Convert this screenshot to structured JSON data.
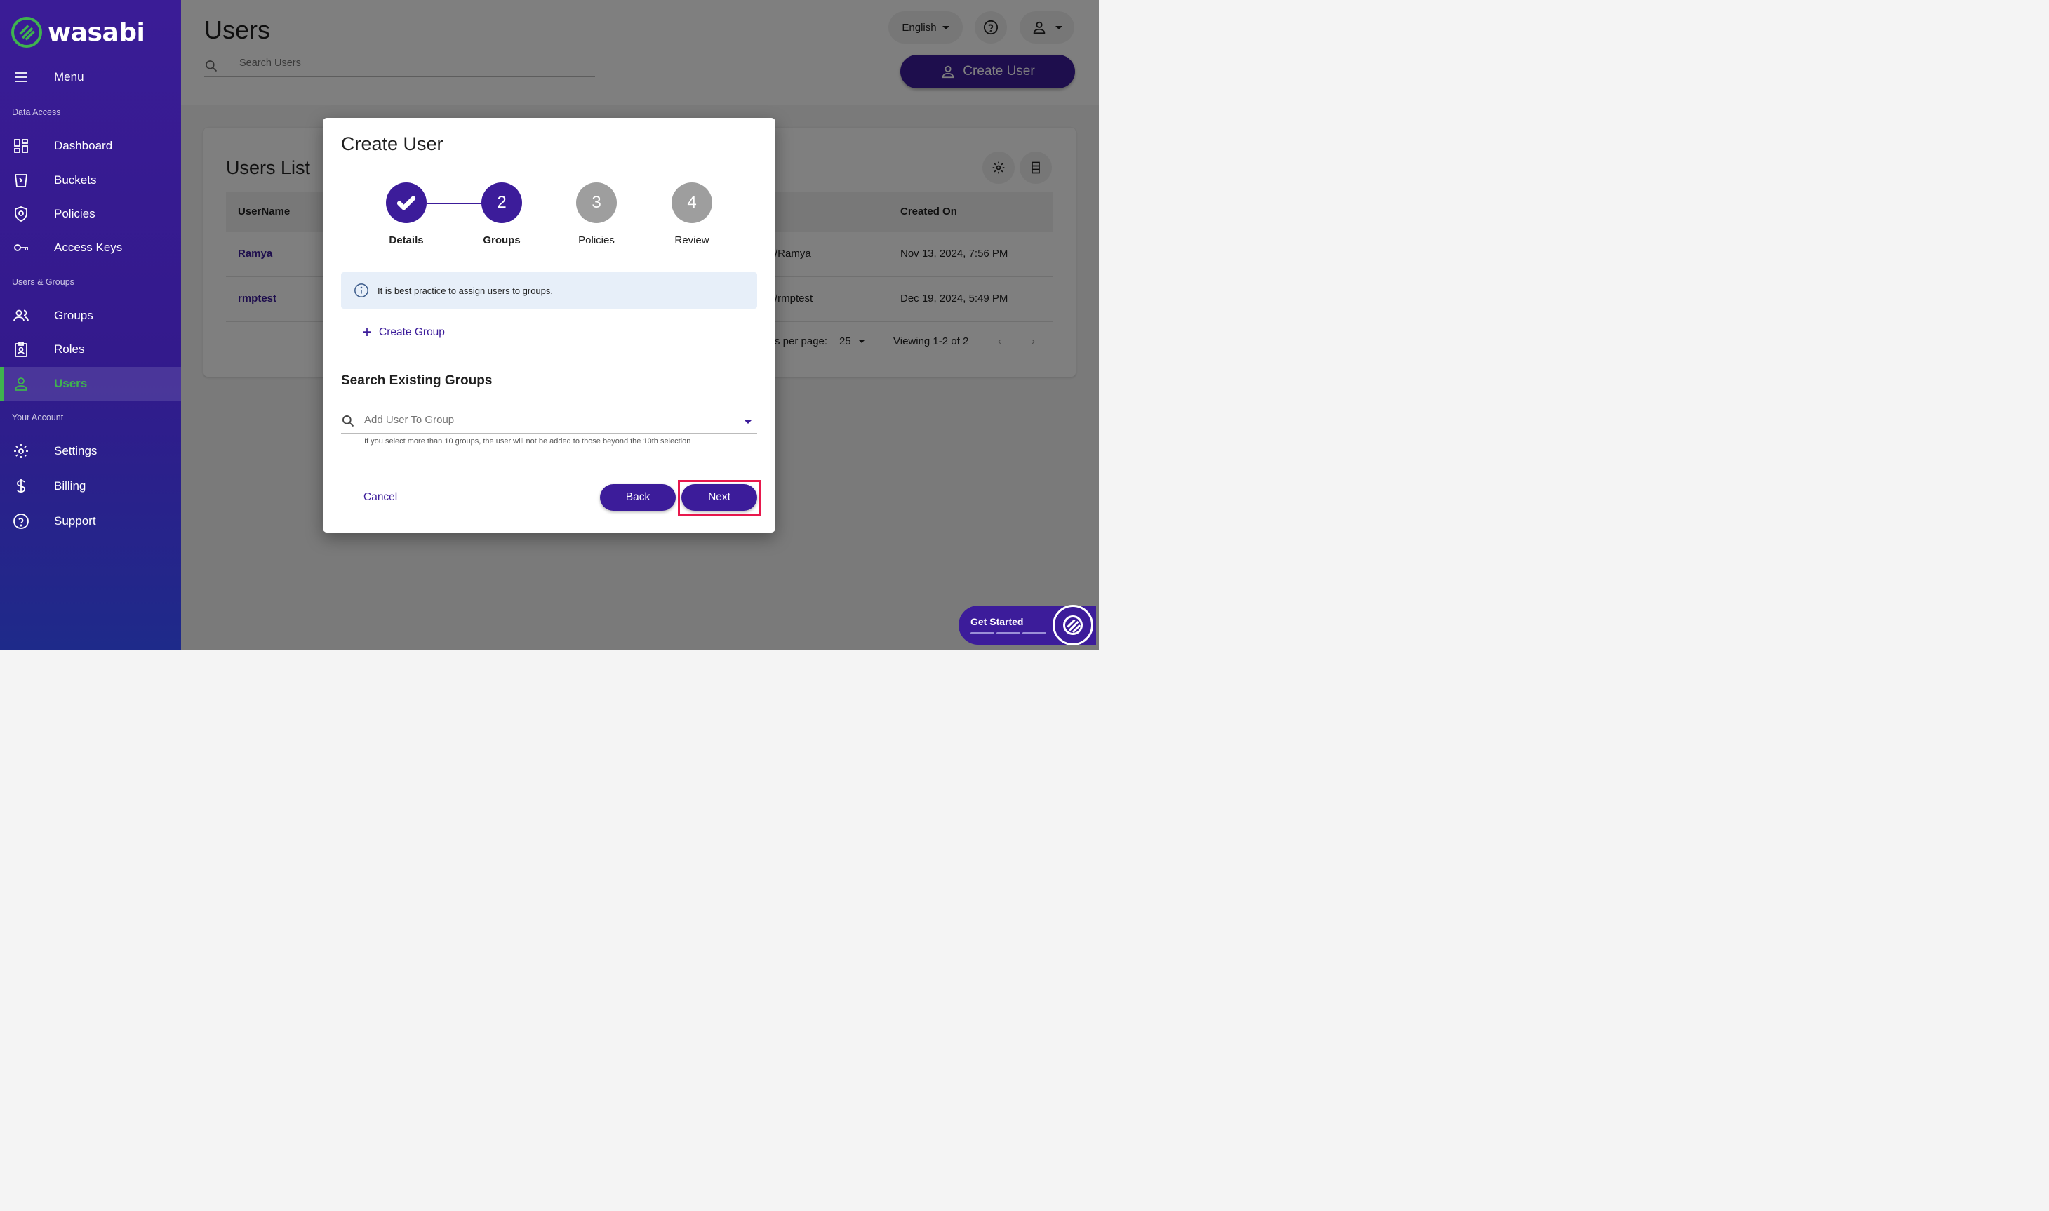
{
  "app": {
    "logo_text": "wasabi"
  },
  "sidebar": {
    "menu_label": "Menu",
    "sections": {
      "data_access": "Data Access",
      "users_groups": "Users & Groups",
      "your_account": "Your Account"
    },
    "items": [
      {
        "label": "Dashboard",
        "icon": "dashboard-icon"
      },
      {
        "label": "Buckets",
        "icon": "bucket-icon"
      },
      {
        "label": "Policies",
        "icon": "shield-icon"
      },
      {
        "label": "Access Keys",
        "icon": "key-icon"
      },
      {
        "label": "Groups",
        "icon": "group-icon"
      },
      {
        "label": "Roles",
        "icon": "badge-icon"
      },
      {
        "label": "Users",
        "icon": "user-icon",
        "active": true
      },
      {
        "label": "Settings",
        "icon": "gear-icon"
      },
      {
        "label": "Billing",
        "icon": "dollar-icon"
      },
      {
        "label": "Support",
        "icon": "help-icon"
      }
    ]
  },
  "header": {
    "title": "Users",
    "search_placeholder": "Search Users",
    "language": "English",
    "create_user_label": "Create User"
  },
  "users_list": {
    "title": "Users List",
    "columns": {
      "username": "UserName",
      "created_on": "Created On"
    },
    "rows": [
      {
        "username": "Ramya",
        "arn_tail": "/Ramya",
        "created_on": "Nov 13, 2024, 7:56 PM"
      },
      {
        "username": "rmptest",
        "arn_tail": "/rmptest",
        "created_on": "Dec 19, 2024, 5:49 PM"
      }
    ],
    "rows_per_page_label": "s per page:",
    "rows_per_page_value": "25",
    "viewing": "Viewing 1-2 of 2"
  },
  "modal": {
    "title": "Create User",
    "steps": [
      {
        "number": "1",
        "label": "Details",
        "state": "done"
      },
      {
        "number": "2",
        "label": "Groups",
        "state": "current"
      },
      {
        "number": "3",
        "label": "Policies",
        "state": "todo"
      },
      {
        "number": "4",
        "label": "Review",
        "state": "todo"
      }
    ],
    "info_text": "It is best practice to assign users to groups.",
    "create_group_label": "Create Group",
    "search_heading": "Search Existing Groups",
    "group_search_placeholder": "Add User To Group",
    "hint": "If you select more than 10 groups, the user will not be added to those beyond the 10th selection",
    "cancel_label": "Cancel",
    "back_label": "Back",
    "next_label": "Next"
  },
  "widget": {
    "get_started_label": "Get Started"
  },
  "colors": {
    "primary": "#3c1c9a",
    "accent_green": "#3fb34f",
    "highlight": "#e8184d"
  }
}
